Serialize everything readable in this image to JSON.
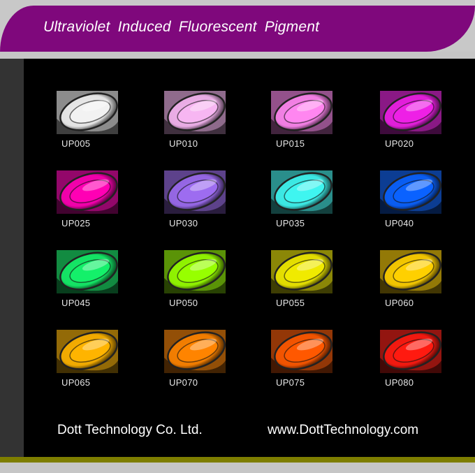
{
  "header": {
    "title": "Ultraviolet  Induced  Fluorescent  Pigment"
  },
  "pigments": [
    {
      "code": "UP005",
      "color": "#f2f2f2"
    },
    {
      "code": "UP010",
      "color": "#f7b6f2"
    },
    {
      "code": "UP015",
      "color": "#ff86f0"
    },
    {
      "code": "UP020",
      "color": "#ee20e6"
    },
    {
      "code": "UP025",
      "color": "#ff00b4"
    },
    {
      "code": "UP030",
      "color": "#9d6cf0"
    },
    {
      "code": "UP035",
      "color": "#3ff5f0"
    },
    {
      "code": "UP040",
      "color": "#0a62ff"
    },
    {
      "code": "UP045",
      "color": "#14f06a"
    },
    {
      "code": "UP050",
      "color": "#97ff00"
    },
    {
      "code": "UP055",
      "color": "#f0ea00"
    },
    {
      "code": "UP060",
      "color": "#ffd000"
    },
    {
      "code": "UP065",
      "color": "#ffb400"
    },
    {
      "code": "UP070",
      "color": "#ff8400"
    },
    {
      "code": "UP075",
      "color": "#ff5800"
    },
    {
      "code": "UP080",
      "color": "#ff1a10"
    }
  ],
  "footer": {
    "company": "Dott Technology Co. Ltd.",
    "website": "www.DottTechnology.com"
  }
}
